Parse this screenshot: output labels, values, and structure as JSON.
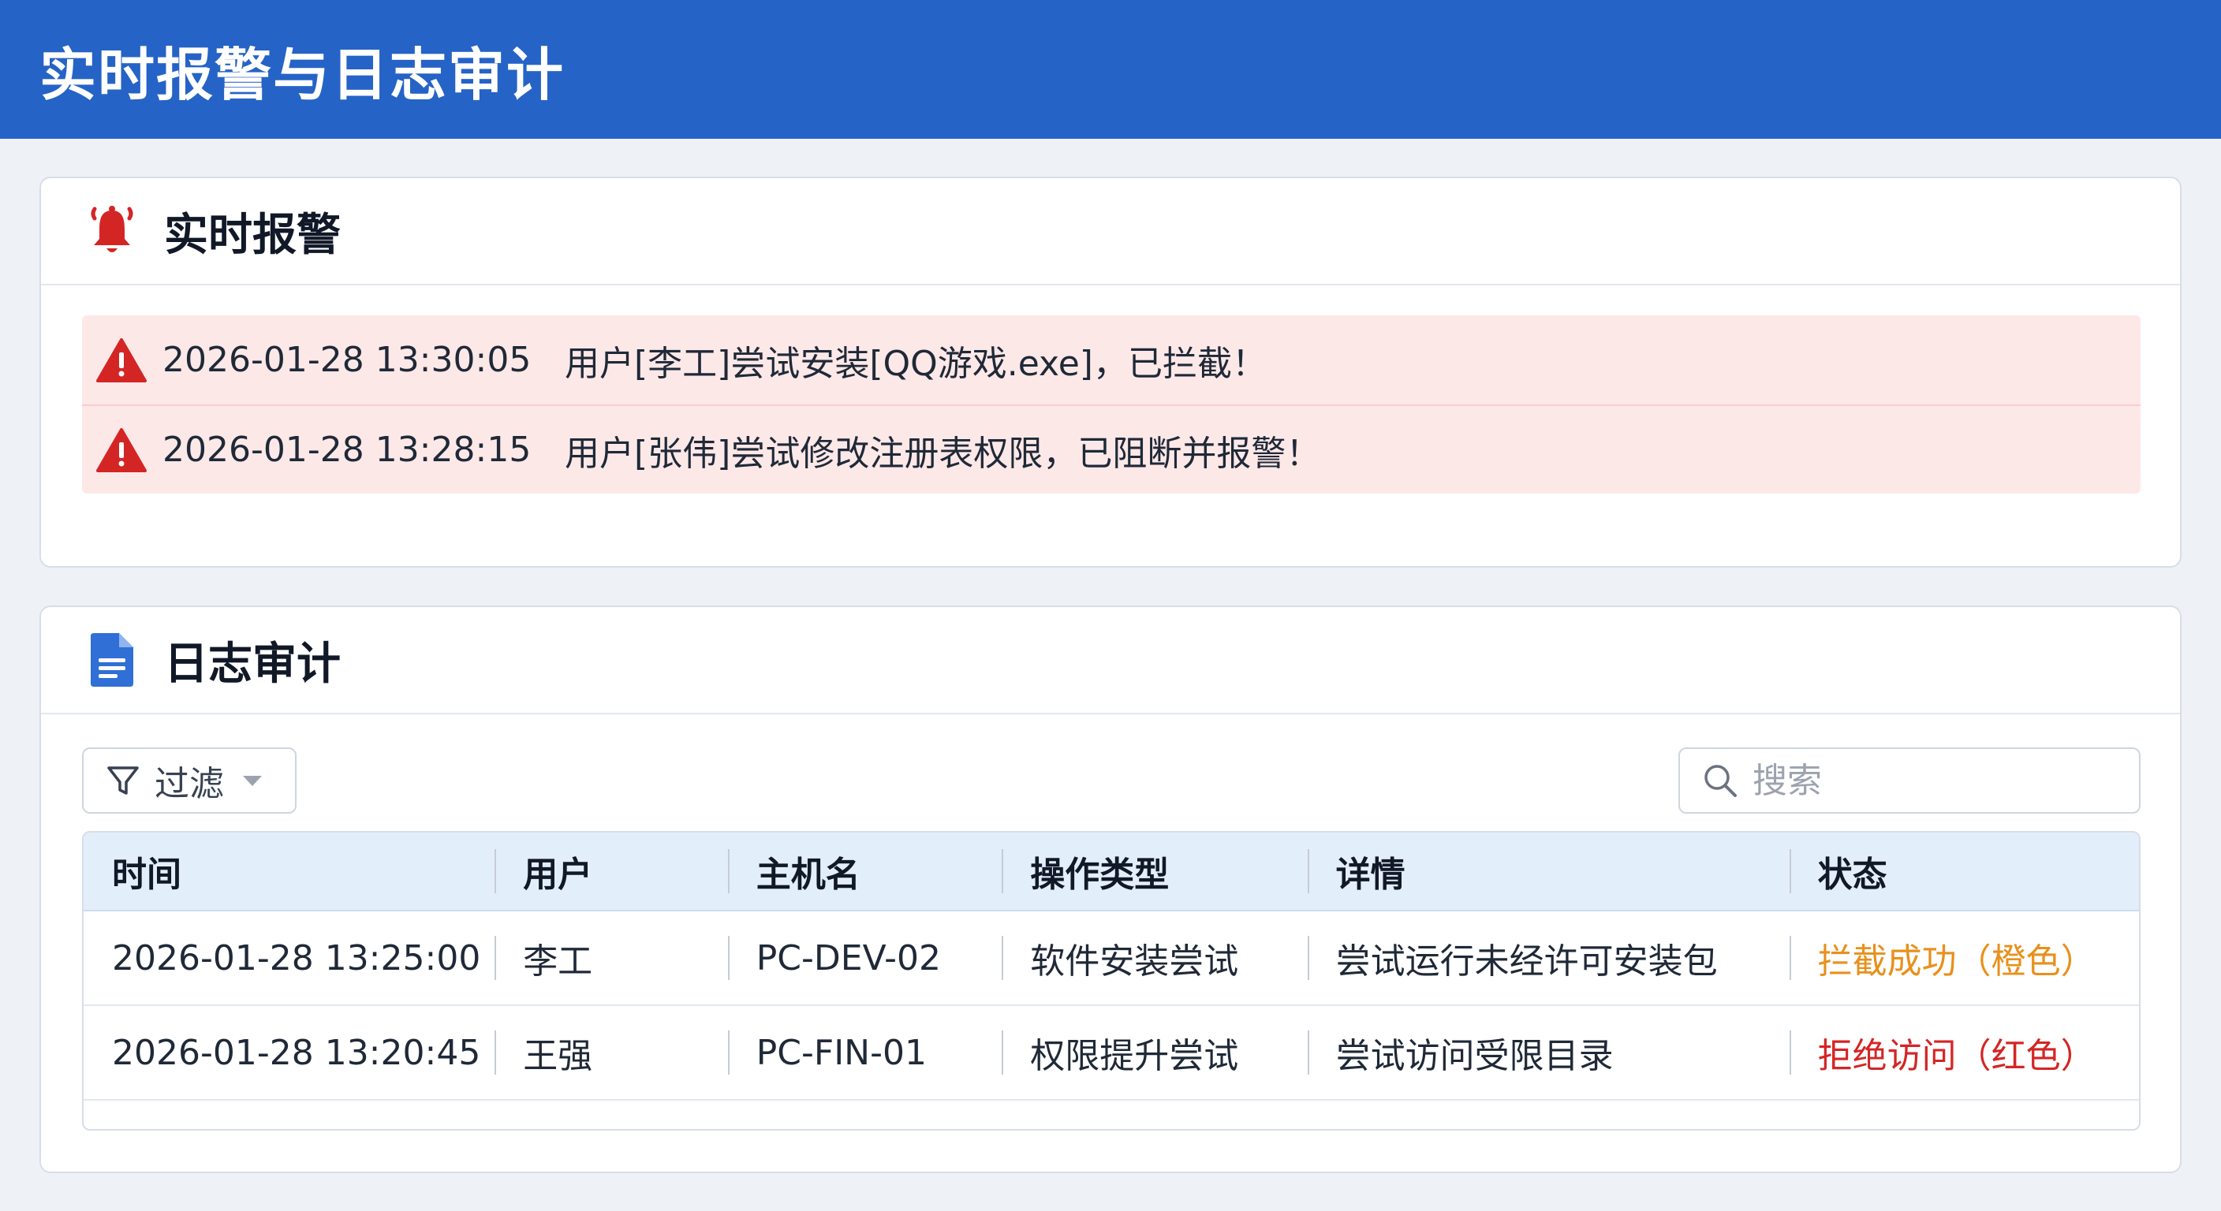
{
  "app": {
    "title": "实时报警与日志审计"
  },
  "alarm_section": {
    "title": "实时报警",
    "icon": "bell-icon",
    "alerts": [
      {
        "time": "2026-01-28 13:30:05",
        "message": "用户[李工]尝试安装[QQ游戏.exe]，已拦截！"
      },
      {
        "time": "2026-01-28 13:28:15",
        "message": "用户[张伟]尝试修改注册表权限，已阻断并报警！"
      }
    ]
  },
  "log_section": {
    "title": "日志审计",
    "icon": "document-icon",
    "filter_label": "过滤",
    "search_placeholder": "搜索",
    "columns": [
      "时间",
      "用户",
      "主机名",
      "操作类型",
      "详情",
      "状态"
    ],
    "rows": [
      {
        "time": "2026-01-28 13:25:00",
        "user": "李工",
        "host": "PC-DEV-02",
        "op": "软件安装尝试",
        "detail": "尝试运行未经许可安装包",
        "status": "拦截成功（橙色）",
        "status_color": "#e8901c"
      },
      {
        "time": "2026-01-28 13:20:45",
        "user": "王强",
        "host": "PC-FIN-01",
        "op": "权限提升尝试",
        "detail": "尝试访问受限目录",
        "status": "拒绝访问（红色）",
        "status_color": "#d42525"
      }
    ]
  },
  "colors": {
    "header_bg": "#2563c6",
    "alert_bg": "#fde8e8",
    "alert_icon": "#d42525",
    "doc_icon": "#2f6fd6"
  }
}
